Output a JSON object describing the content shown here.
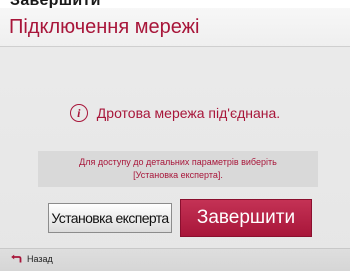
{
  "header": {
    "cropped_title": "Завершити"
  },
  "dialog": {
    "title": "Підключення мережі",
    "status_message": "Дротова мережа під'єднана.",
    "hint_line1": "Для доступу до детальних параметрів виберіть",
    "hint_line2": "[Установка експерта].",
    "expert_button": "Установка експерта",
    "finish_button": "Завершити"
  },
  "footer": {
    "back_label": "Назад"
  },
  "icons": {
    "status": "info-icon",
    "back": "back-arrow-icon"
  },
  "colors": {
    "accent": "#a8163a",
    "background": "#e8e8e8",
    "hint_box": "#d9d9d9"
  }
}
